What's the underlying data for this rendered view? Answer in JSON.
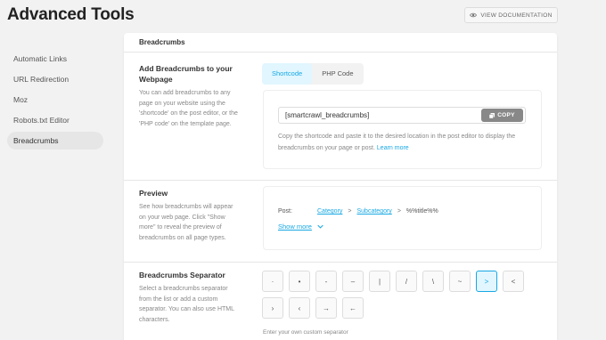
{
  "header": {
    "title": "Advanced Tools",
    "doc_button_label": "VIEW DOCUMENTATION"
  },
  "sidebar": {
    "items": [
      {
        "label": "Automatic Links"
      },
      {
        "label": "URL Redirection"
      },
      {
        "label": "Moz"
      },
      {
        "label": "Robots.txt Editor"
      },
      {
        "label": "Breadcrumbs",
        "active": true
      }
    ]
  },
  "panel": {
    "title": "Breadcrumbs",
    "add": {
      "title": "Add Breadcrumbs to your Webpage",
      "desc": "You can add breadcrumbs to any page on your website using the 'shortcode' on the post editor, or the 'PHP code' on the template page.",
      "tabs": [
        {
          "label": "Shortcode",
          "active": true
        },
        {
          "label": "PHP Code"
        }
      ],
      "shortcode_value": "[smartcrawl_breadcrumbs]",
      "copy_label": "COPY",
      "help_text": "Copy the shortcode and paste it to the desired location in the post editor to display the breadcrumbs on your page or post.",
      "learn_more": "Learn more"
    },
    "preview": {
      "title": "Preview",
      "desc": "See how breadcrumbs will appear on your web page. Click \"Show more\" to reveal the preview of breadcrumbs on all page types.",
      "post_label": "Post:",
      "crumb_category": "Category",
      "crumb_subcategory": "Subcategory",
      "crumb_title": "%%title%%",
      "separator": ">",
      "show_more": "Show more"
    },
    "separator": {
      "title": "Breadcrumbs Separator",
      "desc": "Select a breadcrumbs separator from the list or add a custom separator. You can also use HTML characters.",
      "options": [
        "·",
        "•",
        "-",
        "–",
        "|",
        "/",
        "\\",
        "~",
        ">",
        "<",
        "›",
        "‹",
        "→",
        "←"
      ],
      "selected": ">",
      "custom_label": "Enter your own custom separator"
    }
  },
  "colors": {
    "accent": "#17a8e3",
    "active_bg": "#e1f6ff",
    "copy_button": "#888888"
  }
}
